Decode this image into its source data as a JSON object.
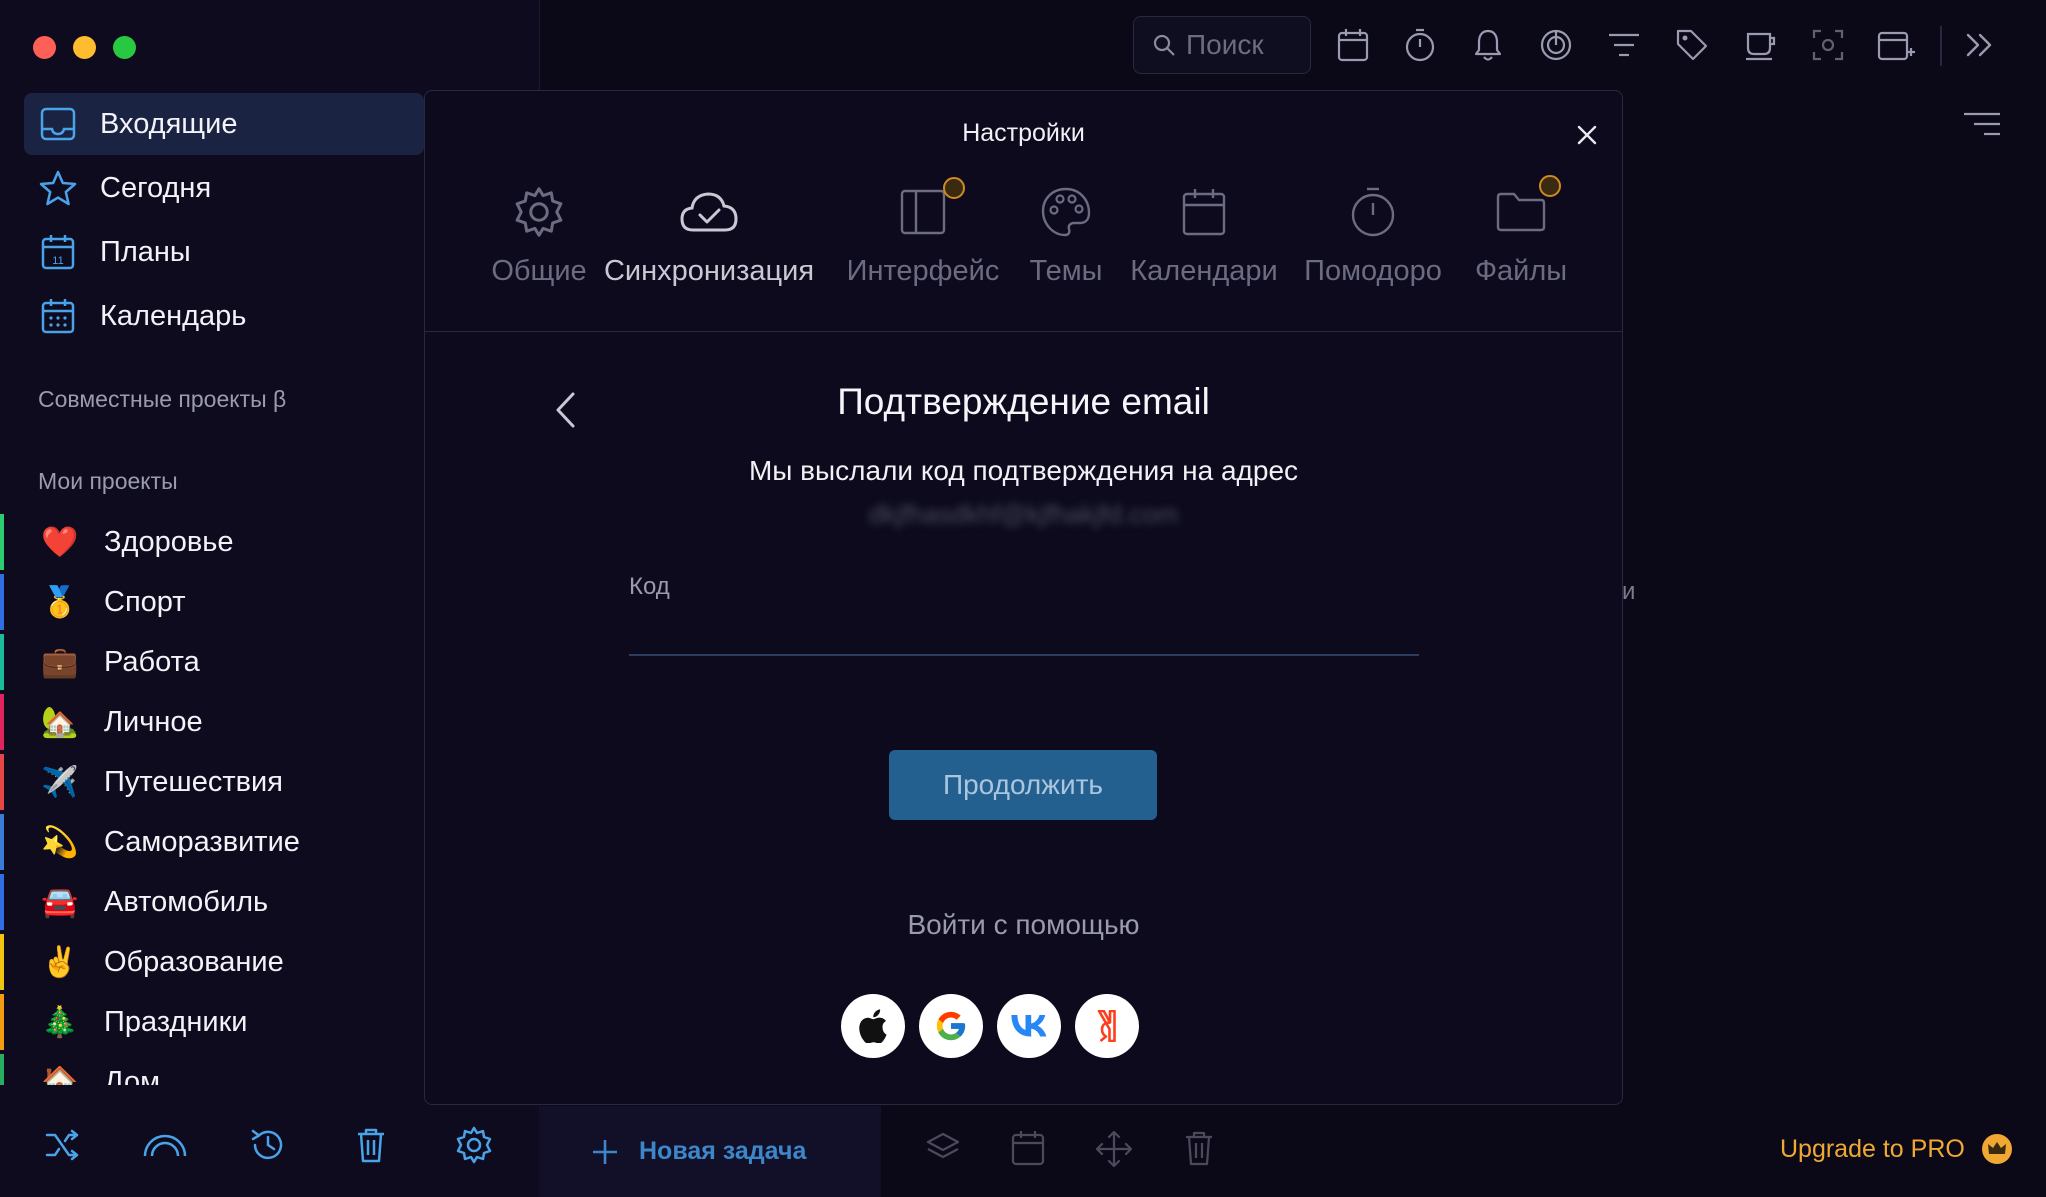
{
  "sidebar": {
    "nav": [
      {
        "label": "Входящие",
        "icon": "inbox-icon"
      },
      {
        "label": "Сегодня",
        "icon": "star-icon"
      },
      {
        "label": "Планы",
        "icon": "calendar-plans-icon"
      },
      {
        "label": "Календарь",
        "icon": "calendar-icon"
      }
    ],
    "shared_label": "Совместные проекты β",
    "projects_label": "Мои проекты",
    "projects": [
      {
        "label": "Здоровье",
        "emoji": "❤️",
        "color": "#2ecc71"
      },
      {
        "label": "Спорт",
        "emoji": "🥇",
        "color": "#2f6fe0"
      },
      {
        "label": "Работа",
        "emoji": "💼",
        "color": "#1abc9c"
      },
      {
        "label": "Личное",
        "emoji": "🏡",
        "color": "#e0245e"
      },
      {
        "label": "Путешествия",
        "emoji": "✈️",
        "color": "#e64545"
      },
      {
        "label": "Саморазвитие",
        "emoji": "💫",
        "color": "#3a7bd5"
      },
      {
        "label": "Автомобиль",
        "emoji": "🚘",
        "color": "#2f6fe0"
      },
      {
        "label": "Образование",
        "emoji": "✌️",
        "color": "#f1c40f"
      },
      {
        "label": "Праздники",
        "emoji": "🎄",
        "color": "#f39c12"
      },
      {
        "label": "Дом",
        "emoji": "🏠",
        "color": "#27ae60"
      }
    ]
  },
  "toolbar": {
    "search_placeholder": "Поиск"
  },
  "bottom": {
    "new_task": "Новая задача",
    "upgrade": "Upgrade to PRO"
  },
  "modal": {
    "title": "Настройки",
    "tabs": [
      {
        "label": "Общие",
        "icon": "gear-icon"
      },
      {
        "label": "Синхронизация",
        "icon": "cloud-sync-icon",
        "active": true
      },
      {
        "label": "Интерфейс",
        "icon": "layout-icon",
        "pro": true
      },
      {
        "label": "Темы",
        "icon": "palette-icon"
      },
      {
        "label": "Календари",
        "icon": "calendar-icon"
      },
      {
        "label": "Помодоро",
        "icon": "timer-icon"
      },
      {
        "label": "Файлы",
        "icon": "folder-icon",
        "pro": true
      }
    ],
    "confirm_title": "Подтверждение email",
    "confirm_subtitle": "Мы выслали код подтверждения на адрес",
    "email_blurred": "dkjfhasdkhf@kjfhakjfd.com",
    "code_label": "Код",
    "code_value": "",
    "continue": "Продолжить",
    "login_with": "Войти с помощью",
    "social": [
      "apple-icon",
      "google-icon",
      "vk-icon",
      "yandex-icon"
    ]
  },
  "background": {
    "overflow_text": "и"
  },
  "colors": {
    "accent": "#3d86c9",
    "button": "#24608f",
    "pro": "#f0a832"
  }
}
